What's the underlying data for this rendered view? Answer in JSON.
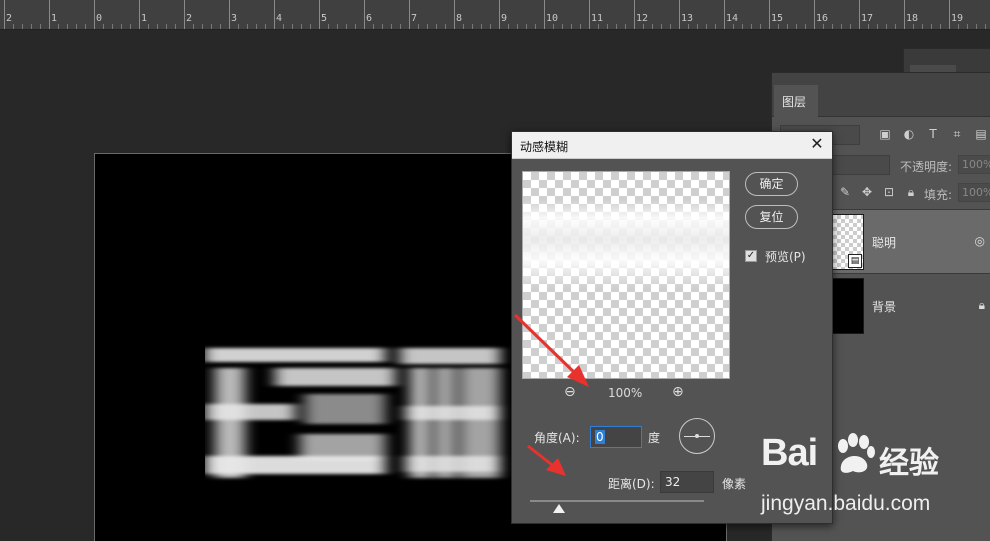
{
  "ruler": {
    "labels": [
      "2",
      "1",
      "0",
      "1",
      "2",
      "3",
      "4",
      "5",
      "6",
      "7",
      "8",
      "9",
      "10",
      "11",
      "12",
      "13",
      "14",
      "15",
      "16",
      "17",
      "18",
      "19"
    ]
  },
  "layers_panel": {
    "back_tab_label": "图层",
    "tab_label": "图层",
    "opacity_label": "不透明度:",
    "opacity_value": "100%",
    "fill_label": "填充:",
    "fill_value": "100%",
    "layers": [
      {
        "name": "聪明",
        "selected": true
      },
      {
        "name": "背景",
        "selected": false
      }
    ]
  },
  "dialog": {
    "title": "动感模糊",
    "ok_label": "确定",
    "reset_label": "复位",
    "preview_label": "预览(P)",
    "preview_checked": true,
    "zoom_value": "100%",
    "angle_label": "角度(A):",
    "angle_value": "0",
    "angle_unit": "度",
    "distance_label": "距离(D):",
    "distance_value": "32",
    "distance_unit": "像素"
  },
  "watermark": {
    "logo": "Bai",
    "cn_text": "经验",
    "url": "jingyan.baidu.com"
  },
  "colors": {
    "arrow": "#e8322e",
    "focus_blue": "#2f7fd6"
  }
}
